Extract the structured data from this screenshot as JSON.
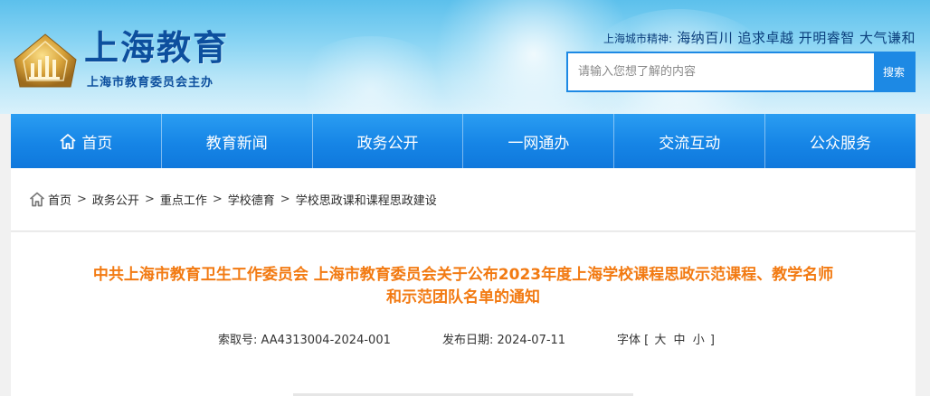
{
  "header": {
    "logo_title": "上海教育",
    "logo_subtitle": "上海市教育委员会主办",
    "motto_label": "上海城市精神:",
    "motto_text": "海纳百川 追求卓越 开明睿智 大气谦和",
    "search_placeholder": "请输入您想了解的内容",
    "search_button": "搜索"
  },
  "nav": {
    "items": [
      {
        "label": "首页"
      },
      {
        "label": "教育新闻"
      },
      {
        "label": "政务公开"
      },
      {
        "label": "一网通办"
      },
      {
        "label": "交流互动"
      },
      {
        "label": "公众服务"
      }
    ]
  },
  "breadcrumb": {
    "items": [
      "首页",
      "政务公开",
      "重点工作",
      "学校德育",
      "学校思政课和课程思政建设"
    ],
    "separator": ">"
  },
  "article": {
    "title_line1": "中共上海市教育卫生工作委员会 上海市教育委员会关于公布2023年度上海学校课程思政示范课程、教学名师",
    "title_line2": "和示范团队名单的通知",
    "index_label": "索取号:",
    "index_value": "AA4313004-2024-001",
    "date_label": "发布日期:",
    "date_value": "2024-07-11",
    "font_label": "字体",
    "font_open": "[",
    "font_large": "大",
    "font_medium": "中",
    "font_small": "小",
    "font_close": "]"
  },
  "colors": {
    "brand_blue": "#0d4f9e",
    "nav_blue": "#1685e6",
    "title_orange": "#f27a12"
  },
  "icons": {
    "logo": "shanghai-education-emblem",
    "nav_home": "home-icon",
    "breadcrumb_home": "home-icon"
  }
}
